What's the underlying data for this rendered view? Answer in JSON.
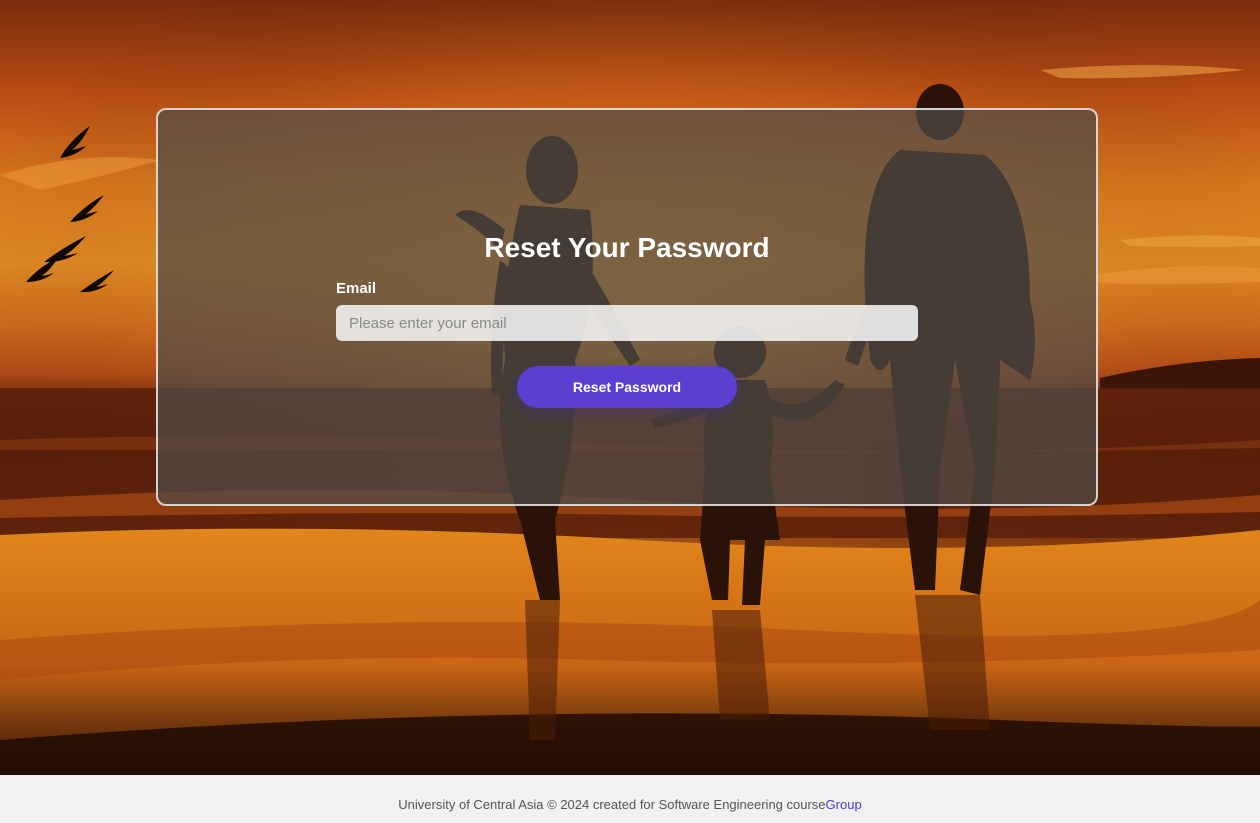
{
  "colors": {
    "accent": "#5b3fd0",
    "link": "#4a3bd6",
    "footer_bg": "#f1f1f1"
  },
  "background": {
    "image_description_icon": "sunset-beach-family-silhouette-image"
  },
  "reset_form": {
    "title": "Reset Your Password",
    "email_label": "Email",
    "email_placeholder": "Please enter your email",
    "email_value": "",
    "submit_label": "Reset Password"
  },
  "footer": {
    "text": "University of Central Asia © 2024 created for Software Engineering course",
    "link_label": "Group"
  }
}
